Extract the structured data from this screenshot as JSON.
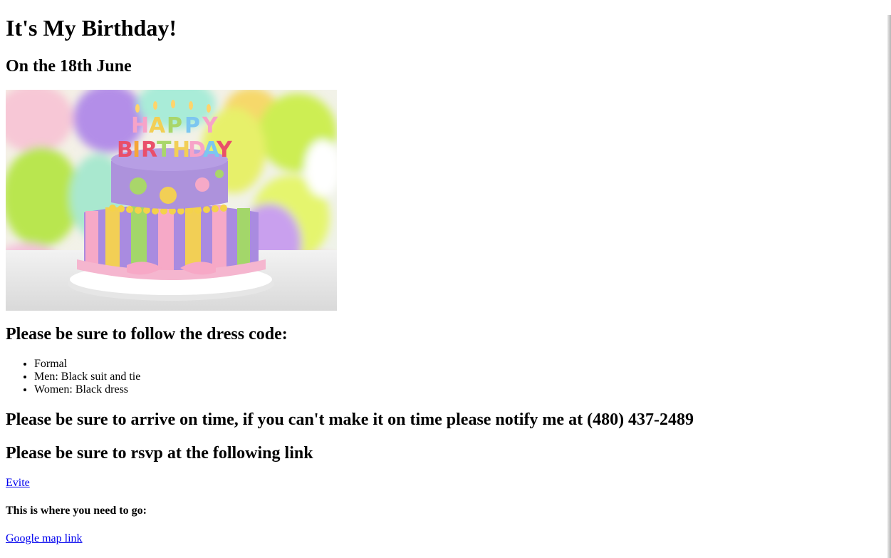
{
  "title": "It's My Birthday!",
  "subtitle": "On the 18th June",
  "image": {
    "alt": "Happy Birthday cake",
    "cake_topper_text": "HAPPY BIRTHDAY"
  },
  "dress_code": {
    "heading": "Please be sure to follow the dress code:",
    "items": [
      "Formal",
      "Men: Black suit and tie",
      "Women: Black dress"
    ]
  },
  "arrive_heading": "Please be sure to arrive on time, if you can't make it on time please notify me at (480) 437-2489",
  "rsvp": {
    "heading": "Please be sure to rsvp at the following link",
    "link_label": "Evite"
  },
  "location": {
    "heading": "This is where you need to go:",
    "link_label": "Google map link"
  },
  "colors": {
    "link": "#0000ee",
    "text": "#000000",
    "background": "#ffffff"
  }
}
